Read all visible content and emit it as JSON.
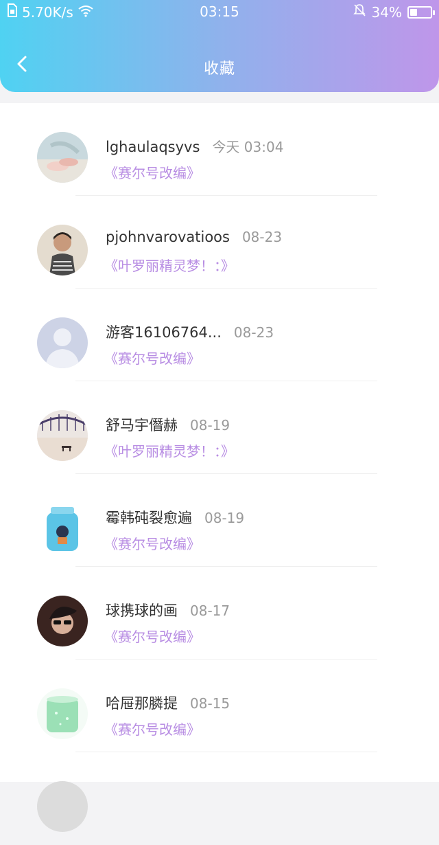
{
  "status_bar": {
    "network_speed": "5.70K/s",
    "time": "03:15",
    "battery_percent": "34%",
    "battery_level": 0.34
  },
  "header": {
    "title": "收藏"
  },
  "favorites": [
    {
      "name": "lghaulaqsyvs",
      "date": "今天 03:04",
      "work": "《赛尔号改编》"
    },
    {
      "name": "pjohnvarovatioos",
      "date": "08-23",
      "work": "《叶罗丽精灵梦！：》"
    },
    {
      "name": "游客16106764...",
      "date": "08-23",
      "work": "《赛尔号改编》"
    },
    {
      "name": "舒马宇僭赫",
      "date": "08-19",
      "work": "《叶罗丽精灵梦！：》"
    },
    {
      "name": "霉韩砘裂愈遍",
      "date": "08-19",
      "work": "《赛尔号改编》"
    },
    {
      "name": "球携球的画",
      "date": "08-17",
      "work": "《赛尔号改编》"
    },
    {
      "name": "哈屉那膦提",
      "date": "08-15",
      "work": "《赛尔号改编》"
    }
  ],
  "colors": {
    "gradient_start": "#4fd2f2",
    "gradient_end": "#bf96ea",
    "work_title": "#b88de3"
  }
}
